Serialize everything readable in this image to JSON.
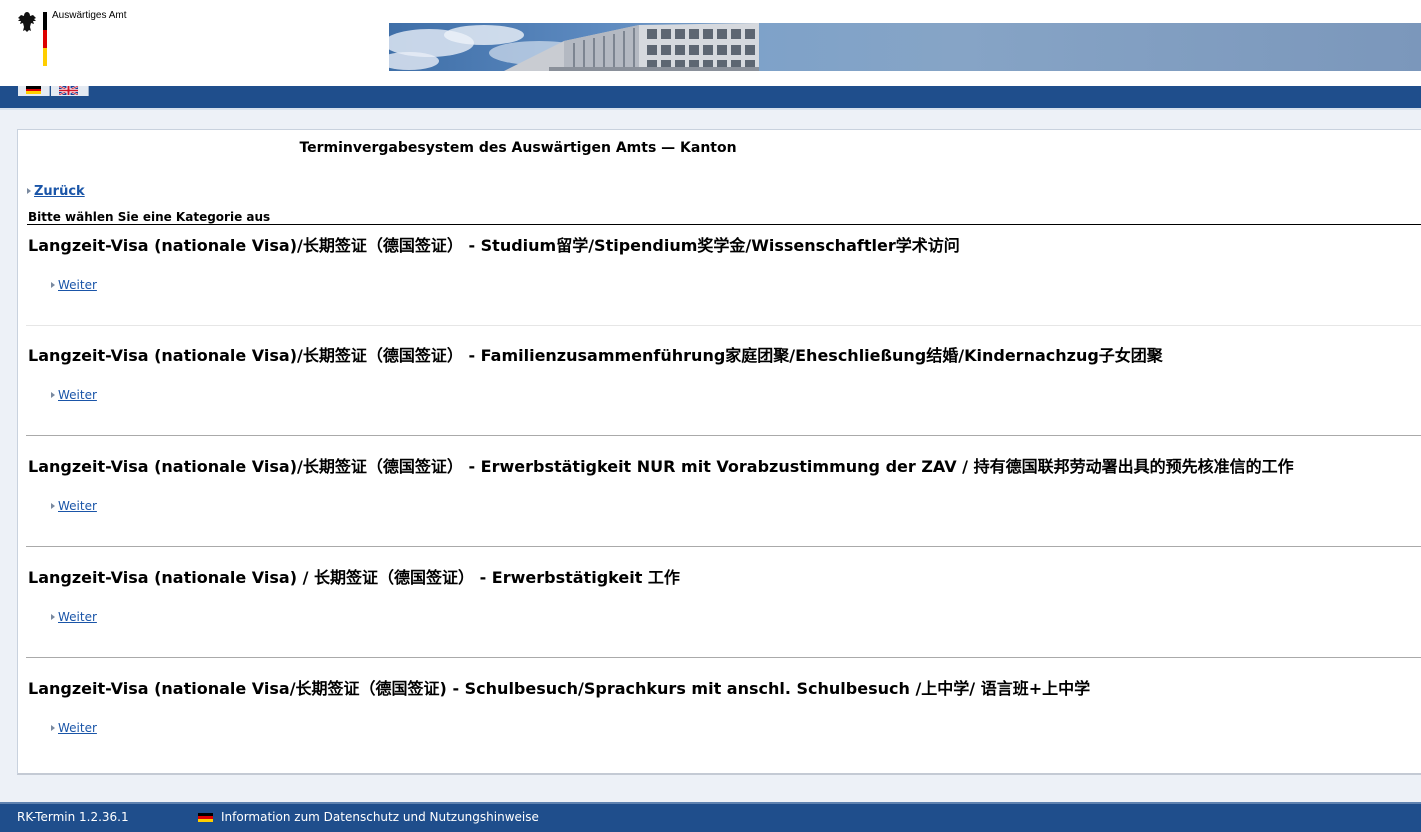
{
  "header": {
    "agency_name": "Auswärtiges Amt"
  },
  "nav": {
    "languages": [
      "de-flag-icon",
      "gb-flag-icon"
    ]
  },
  "main": {
    "title": "Terminvergabesystem des Auswärtigen Amts — Kanton",
    "back_label": "Zurück",
    "instruction": "Bitte wählen Sie eine Kategorie aus",
    "categories": [
      {
        "title": "Langzeit-Visa (nationale Visa)/长期签证（德国签证） - Studium留学/Stipendium奖学金/Wissenschaftler学术访问",
        "link": "Weiter"
      },
      {
        "title": "Langzeit-Visa (nationale Visa)/长期签证（德国签证） - Familienzusammenführung家庭团聚/Eheschließung结婚/Kindernachzug子女团聚",
        "link": "Weiter"
      },
      {
        "title": "Langzeit-Visa (nationale Visa)/长期签证（德国签证） - Erwerbstätigkeit NUR mit Vorabzustimmung der ZAV / 持有德国联邦劳动署出具的预先核准信的工作",
        "link": "Weiter"
      },
      {
        "title": "Langzeit-Visa (nationale Visa) / 长期签证（德国签证） - Erwerbstätigkeit 工作",
        "link": "Weiter"
      },
      {
        "title": "Langzeit-Visa (nationale Visa/长期签证（德国签证) - Schulbesuch/Sprachkurs mit anschl. Schulbesuch /上中学/ 语言班+上中学",
        "link": "Weiter"
      }
    ]
  },
  "footer": {
    "version": "RK-Termin 1.2.36.1",
    "privacy_label": "Information zum Datenschutz und Nutzungshinweise"
  },
  "colors": {
    "nav_bar": "#1f4e8c",
    "link": "#1a55a8",
    "page_background": "#edf1f7"
  }
}
